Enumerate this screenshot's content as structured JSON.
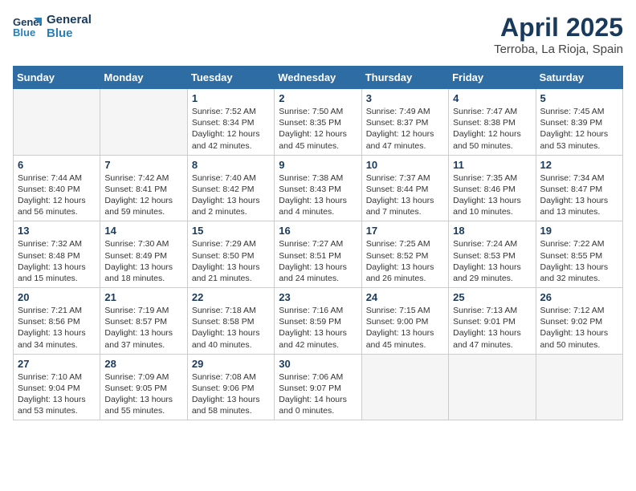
{
  "header": {
    "logo_line1": "General",
    "logo_line2": "Blue",
    "month_title": "April 2025",
    "location": "Terroba, La Rioja, Spain"
  },
  "days_of_week": [
    "Sunday",
    "Monday",
    "Tuesday",
    "Wednesday",
    "Thursday",
    "Friday",
    "Saturday"
  ],
  "weeks": [
    [
      {
        "day": "",
        "empty": true
      },
      {
        "day": "",
        "empty": true
      },
      {
        "day": "1",
        "sunrise": "Sunrise: 7:52 AM",
        "sunset": "Sunset: 8:34 PM",
        "daylight": "Daylight: 12 hours and 42 minutes."
      },
      {
        "day": "2",
        "sunrise": "Sunrise: 7:50 AM",
        "sunset": "Sunset: 8:35 PM",
        "daylight": "Daylight: 12 hours and 45 minutes."
      },
      {
        "day": "3",
        "sunrise": "Sunrise: 7:49 AM",
        "sunset": "Sunset: 8:37 PM",
        "daylight": "Daylight: 12 hours and 47 minutes."
      },
      {
        "day": "4",
        "sunrise": "Sunrise: 7:47 AM",
        "sunset": "Sunset: 8:38 PM",
        "daylight": "Daylight: 12 hours and 50 minutes."
      },
      {
        "day": "5",
        "sunrise": "Sunrise: 7:45 AM",
        "sunset": "Sunset: 8:39 PM",
        "daylight": "Daylight: 12 hours and 53 minutes."
      }
    ],
    [
      {
        "day": "6",
        "sunrise": "Sunrise: 7:44 AM",
        "sunset": "Sunset: 8:40 PM",
        "daylight": "Daylight: 12 hours and 56 minutes."
      },
      {
        "day": "7",
        "sunrise": "Sunrise: 7:42 AM",
        "sunset": "Sunset: 8:41 PM",
        "daylight": "Daylight: 12 hours and 59 minutes."
      },
      {
        "day": "8",
        "sunrise": "Sunrise: 7:40 AM",
        "sunset": "Sunset: 8:42 PM",
        "daylight": "Daylight: 13 hours and 2 minutes."
      },
      {
        "day": "9",
        "sunrise": "Sunrise: 7:38 AM",
        "sunset": "Sunset: 8:43 PM",
        "daylight": "Daylight: 13 hours and 4 minutes."
      },
      {
        "day": "10",
        "sunrise": "Sunrise: 7:37 AM",
        "sunset": "Sunset: 8:44 PM",
        "daylight": "Daylight: 13 hours and 7 minutes."
      },
      {
        "day": "11",
        "sunrise": "Sunrise: 7:35 AM",
        "sunset": "Sunset: 8:46 PM",
        "daylight": "Daylight: 13 hours and 10 minutes."
      },
      {
        "day": "12",
        "sunrise": "Sunrise: 7:34 AM",
        "sunset": "Sunset: 8:47 PM",
        "daylight": "Daylight: 13 hours and 13 minutes."
      }
    ],
    [
      {
        "day": "13",
        "sunrise": "Sunrise: 7:32 AM",
        "sunset": "Sunset: 8:48 PM",
        "daylight": "Daylight: 13 hours and 15 minutes."
      },
      {
        "day": "14",
        "sunrise": "Sunrise: 7:30 AM",
        "sunset": "Sunset: 8:49 PM",
        "daylight": "Daylight: 13 hours and 18 minutes."
      },
      {
        "day": "15",
        "sunrise": "Sunrise: 7:29 AM",
        "sunset": "Sunset: 8:50 PM",
        "daylight": "Daylight: 13 hours and 21 minutes."
      },
      {
        "day": "16",
        "sunrise": "Sunrise: 7:27 AM",
        "sunset": "Sunset: 8:51 PM",
        "daylight": "Daylight: 13 hours and 24 minutes."
      },
      {
        "day": "17",
        "sunrise": "Sunrise: 7:25 AM",
        "sunset": "Sunset: 8:52 PM",
        "daylight": "Daylight: 13 hours and 26 minutes."
      },
      {
        "day": "18",
        "sunrise": "Sunrise: 7:24 AM",
        "sunset": "Sunset: 8:53 PM",
        "daylight": "Daylight: 13 hours and 29 minutes."
      },
      {
        "day": "19",
        "sunrise": "Sunrise: 7:22 AM",
        "sunset": "Sunset: 8:55 PM",
        "daylight": "Daylight: 13 hours and 32 minutes."
      }
    ],
    [
      {
        "day": "20",
        "sunrise": "Sunrise: 7:21 AM",
        "sunset": "Sunset: 8:56 PM",
        "daylight": "Daylight: 13 hours and 34 minutes."
      },
      {
        "day": "21",
        "sunrise": "Sunrise: 7:19 AM",
        "sunset": "Sunset: 8:57 PM",
        "daylight": "Daylight: 13 hours and 37 minutes."
      },
      {
        "day": "22",
        "sunrise": "Sunrise: 7:18 AM",
        "sunset": "Sunset: 8:58 PM",
        "daylight": "Daylight: 13 hours and 40 minutes."
      },
      {
        "day": "23",
        "sunrise": "Sunrise: 7:16 AM",
        "sunset": "Sunset: 8:59 PM",
        "daylight": "Daylight: 13 hours and 42 minutes."
      },
      {
        "day": "24",
        "sunrise": "Sunrise: 7:15 AM",
        "sunset": "Sunset: 9:00 PM",
        "daylight": "Daylight: 13 hours and 45 minutes."
      },
      {
        "day": "25",
        "sunrise": "Sunrise: 7:13 AM",
        "sunset": "Sunset: 9:01 PM",
        "daylight": "Daylight: 13 hours and 47 minutes."
      },
      {
        "day": "26",
        "sunrise": "Sunrise: 7:12 AM",
        "sunset": "Sunset: 9:02 PM",
        "daylight": "Daylight: 13 hours and 50 minutes."
      }
    ],
    [
      {
        "day": "27",
        "sunrise": "Sunrise: 7:10 AM",
        "sunset": "Sunset: 9:04 PM",
        "daylight": "Daylight: 13 hours and 53 minutes."
      },
      {
        "day": "28",
        "sunrise": "Sunrise: 7:09 AM",
        "sunset": "Sunset: 9:05 PM",
        "daylight": "Daylight: 13 hours and 55 minutes."
      },
      {
        "day": "29",
        "sunrise": "Sunrise: 7:08 AM",
        "sunset": "Sunset: 9:06 PM",
        "daylight": "Daylight: 13 hours and 58 minutes."
      },
      {
        "day": "30",
        "sunrise": "Sunrise: 7:06 AM",
        "sunset": "Sunset: 9:07 PM",
        "daylight": "Daylight: 14 hours and 0 minutes."
      },
      {
        "day": "",
        "empty": true
      },
      {
        "day": "",
        "empty": true
      },
      {
        "day": "",
        "empty": true
      }
    ]
  ]
}
